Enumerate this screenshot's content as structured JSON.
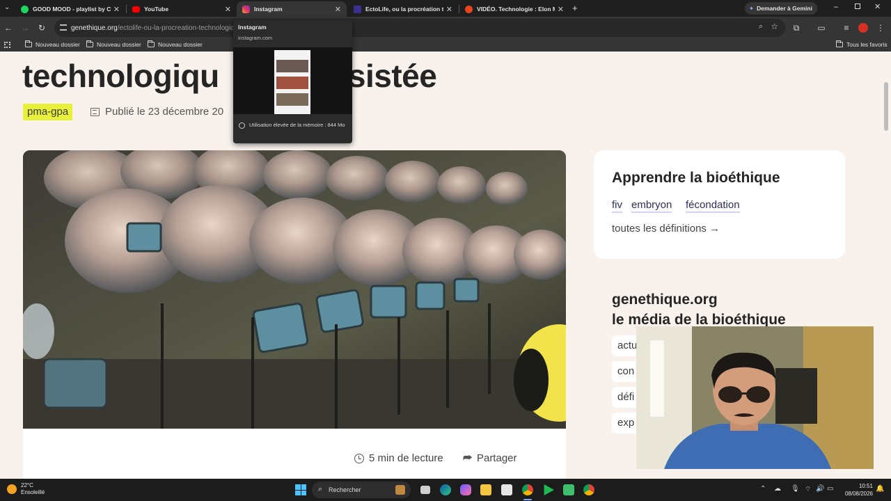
{
  "tabs": [
    {
      "title": "GOOD MOOD - playlist by Cs",
      "favicon": "spotify-icon",
      "color": "#1ed760"
    },
    {
      "title": "YouTube",
      "favicon": "youtube-icon",
      "color": "#ff0000"
    },
    {
      "title": "Instagram",
      "favicon": "instagram-icon",
      "color": "#e1306c"
    },
    {
      "title": "EctoLife, ou la procréation tec",
      "favicon": "genethique-icon",
      "color": "#3b2f8f"
    },
    {
      "title": "VIDÉO. Technologie : Elon Musk",
      "favicon": "video-icon",
      "color": "#e8441e"
    }
  ],
  "gemini_button": "Demander à Gemini",
  "address": {
    "domain": "genethique.org",
    "path": "/ectolife-ou-la-procreation-technologiqu"
  },
  "bookmarks": {
    "folders": [
      "Nouveau dossier",
      "Nouveau dossier",
      "Nouveau dossier"
    ],
    "all": "Tous les favoris"
  },
  "hovercard": {
    "title": "Instagram",
    "url": "instagram.com",
    "memory": "Utilisation élevée de la mémoire : 844 Mo"
  },
  "article": {
    "headline_left": "technologiqu",
    "headline_right": "assistée",
    "tag": "pma-gpa",
    "published": "Publié le 23 décembre 20",
    "read_time": "5 min de lecture",
    "share": "Partager"
  },
  "sidebar": {
    "learn_title": "Apprendre la bioéthique",
    "keywords": [
      "fiv",
      "embryon",
      "fécondation"
    ],
    "all_definitions": "toutes les définitions →",
    "media_line1": "genethique.org",
    "media_line2": "le média de la bioéthique",
    "pills": [
      "actu",
      "con",
      "défi",
      "exp"
    ]
  },
  "taskbar": {
    "temp": "22°C",
    "weather": "Ensoleillé",
    "search": "Rechercher",
    "time": "10:51",
    "date": "08/08/2026"
  }
}
